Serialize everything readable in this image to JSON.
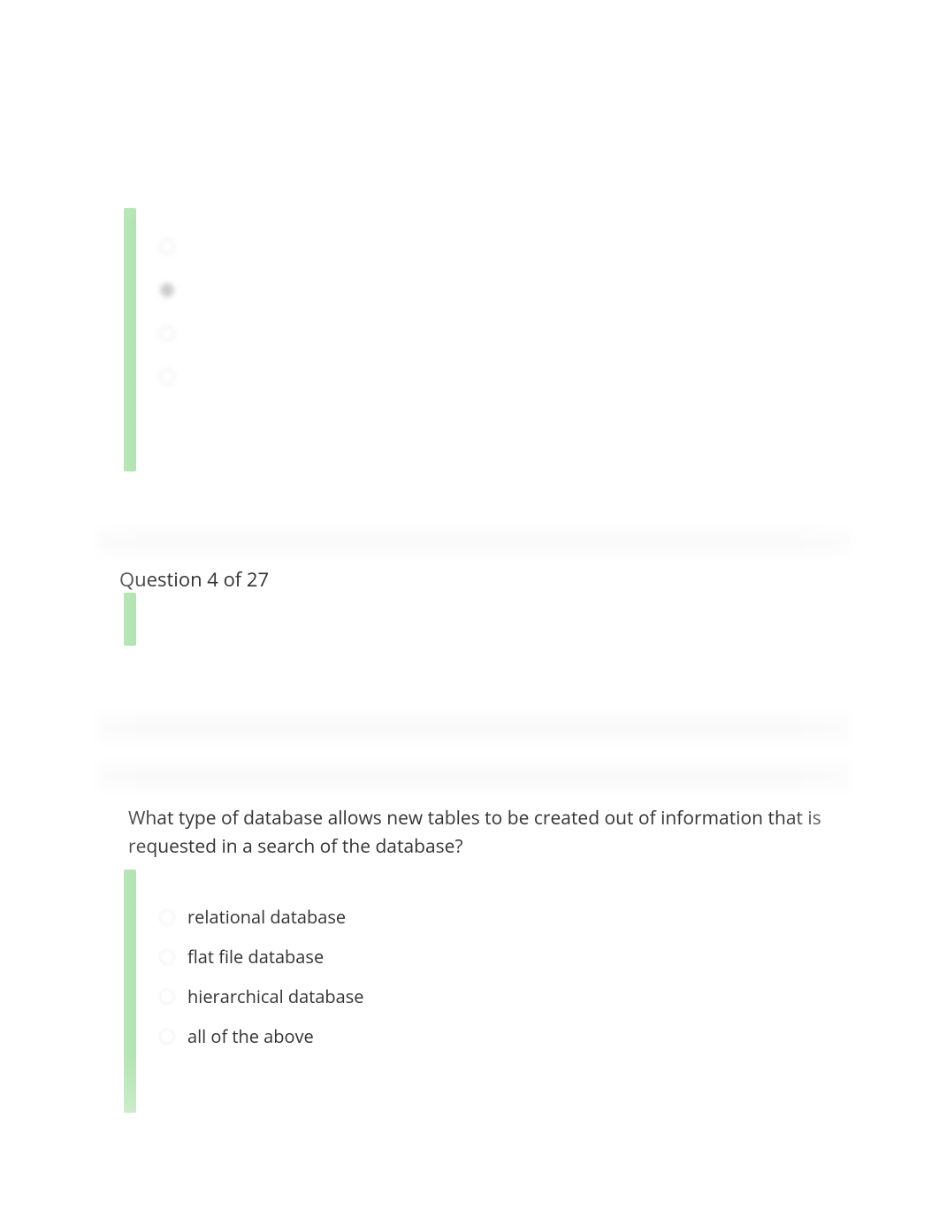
{
  "quiz": {
    "question_header": "Question 4 of 27",
    "question_text": "What type of database allows new tables to be created out of information that is requested in a search of the database?",
    "options": [
      "relational database",
      "flat file database",
      "hierarchical database",
      "all of the above"
    ]
  },
  "colors": {
    "accent_green": "#a7e0a7",
    "text": "#333333"
  }
}
